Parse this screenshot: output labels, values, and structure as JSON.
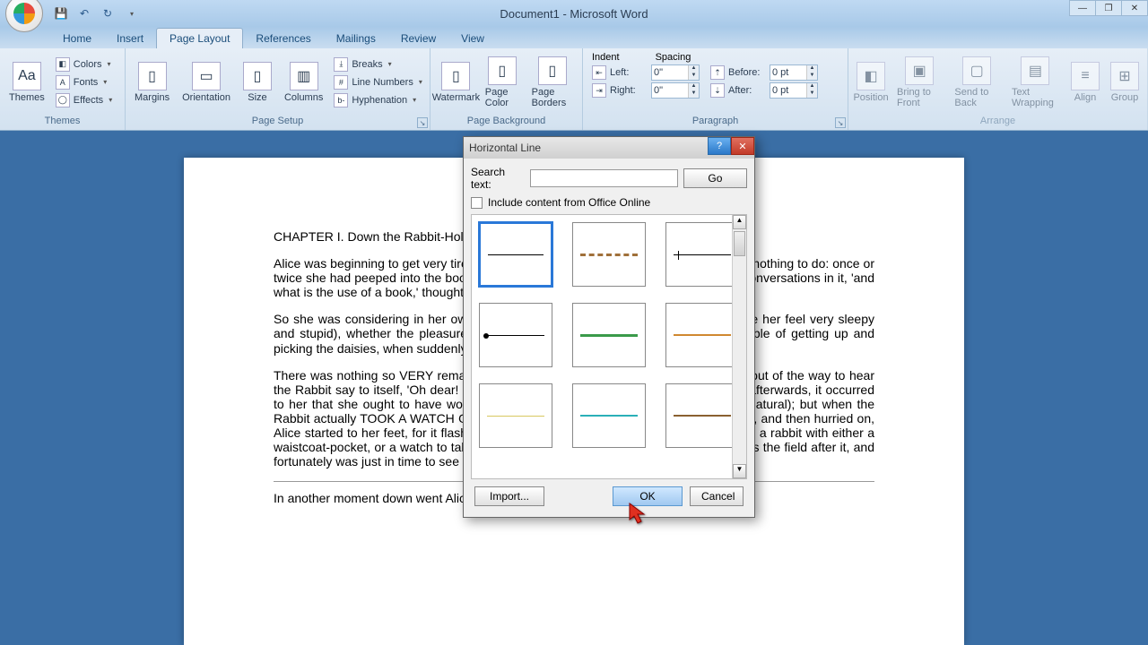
{
  "title": "Document1 - Microsoft Word",
  "qat": {
    "save": "💾",
    "undo": "↶",
    "redo": "↻"
  },
  "tabs": [
    "Home",
    "Insert",
    "Page Layout",
    "References",
    "Mailings",
    "Review",
    "View"
  ],
  "active_tab": 2,
  "ribbon": {
    "themes": {
      "label": "Themes",
      "main": "Themes",
      "colors": "Colors",
      "fonts": "Fonts",
      "effects": "Effects"
    },
    "page_setup": {
      "label": "Page Setup",
      "margins": "Margins",
      "orientation": "Orientation",
      "size": "Size",
      "columns": "Columns",
      "breaks": "Breaks",
      "line_numbers": "Line Numbers",
      "hyphenation": "Hyphenation"
    },
    "page_bg": {
      "label": "Page Background",
      "watermark": "Watermark",
      "page_color": "Page Color",
      "page_borders": "Page Borders"
    },
    "paragraph": {
      "label": "Paragraph",
      "indent": "Indent",
      "spacing": "Spacing",
      "left": "Left:",
      "right": "Right:",
      "before": "Before:",
      "after": "After:",
      "left_val": "0\"",
      "right_val": "0\"",
      "before_val": "0 pt",
      "after_val": "0 pt"
    },
    "arrange": {
      "label": "Arrange",
      "position": "Position",
      "bring_front": "Bring to Front",
      "send_back": "Send to Back",
      "text_wrap": "Text Wrapping",
      "align": "Align",
      "group": "Group"
    }
  },
  "dialog": {
    "title": "Horizontal Line",
    "search_label": "Search text:",
    "search_value": "",
    "go": "Go",
    "include_online": "Include content from Office Online",
    "import": "Import...",
    "ok": "OK",
    "cancel": "Cancel"
  },
  "document": {
    "heading": "CHAPTER I. Down the Rabbit-Hole",
    "p1": "Alice was beginning to get very tired of sitting by her sister on the bank, and of having nothing to do: once or twice she had peeped into the book her sister was reading, but it had no pictures or conversations in it, 'and what is the use of a book,' thought Alice 'without pictures or conversation?'",
    "p2": "So she was considering in her own mind (as well as she could, for the hot day made her feel very sleepy and stupid), whether the pleasure of making a daisy-chain would be worth the trouble of getting up and picking the daisies, when suddenly a White Rabbit with pink eyes ran close by her.",
    "p3": "There was nothing so VERY remarkable in that; nor did Alice think it so VERY much out of the way to hear the Rabbit say to itself, 'Oh dear! Oh dear! I shall be late!' (when she thought it over afterwards, it occurred to her that she ought to have wondered at this, but at the time it all seemed quite natural); but when the Rabbit actually TOOK A WATCH OUT OF ITS WAISTCOAT-POCKET, and looked at it, and then hurried on, Alice started to her feet, for it flashed across her mind that she had never before seen a rabbit with either a waistcoat-pocket, or a watch to take out of it, and burning with curiosity, she ran across the field after it, and fortunately was just in time to see it pop down a large rabbit-hole under the hedge.",
    "p4": "In another moment down went Alice after it, never once considering how"
  }
}
